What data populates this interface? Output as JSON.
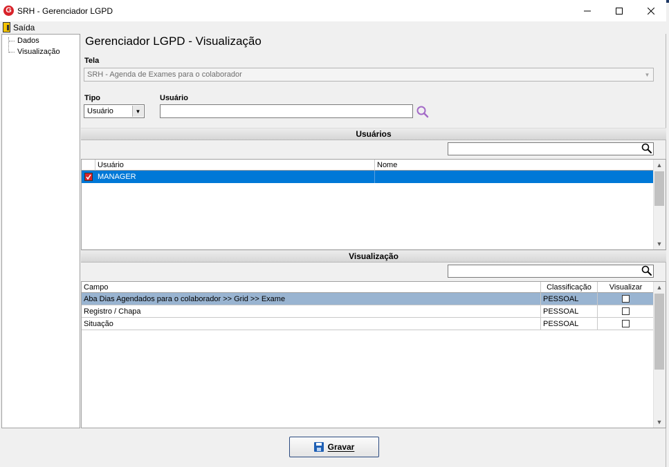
{
  "window": {
    "title": "SRH - Gerenciador LGPD",
    "logo_letter": "G"
  },
  "menu": {
    "exit_label": "Saída"
  },
  "tree": {
    "items": [
      {
        "label": "Dados"
      },
      {
        "label": "Visualização"
      }
    ]
  },
  "page_title": "Gerenciador LGPD - Visualização",
  "form": {
    "tela_label": "Tela",
    "tela_value": "SRH - Agenda de Exames para o colaborador",
    "tipo_label": "Tipo",
    "tipo_value": "Usuário",
    "usuario_label": "Usuário",
    "usuario_value": ""
  },
  "usuarios_section": {
    "title": "Usuários",
    "search_value": "",
    "columns": [
      "Usuário",
      "Nome"
    ],
    "rows": [
      {
        "checked": true,
        "usuario": "MANAGER",
        "nome": "",
        "selected": true
      }
    ]
  },
  "visualizacao_section": {
    "title": "Visualização",
    "search_value": "",
    "columns": [
      "Campo",
      "Classificação",
      "Visualizar"
    ],
    "rows": [
      {
        "campo": "Aba Dias Agendados para o colaborador >> Grid >> Exame",
        "classificacao": "PESSOAL",
        "visualizar": false,
        "selected": true
      },
      {
        "campo": "Registro / Chapa",
        "classificacao": "PESSOAL",
        "visualizar": false,
        "selected": false
      },
      {
        "campo": "Situação",
        "classificacao": "PESSOAL",
        "visualizar": false,
        "selected": false
      }
    ]
  },
  "footer": {
    "save_label": "Gravar"
  },
  "colors": {
    "selection_blue": "#0078d7",
    "selection_light": "#99b4d1",
    "search_purple": "#a36ac7",
    "logo_red": "#d8232a"
  },
  "icons": {
    "logo": "srh-logo-icon",
    "exit": "exit-door-icon",
    "search": "search-icon",
    "save": "floppy-disk-icon"
  }
}
